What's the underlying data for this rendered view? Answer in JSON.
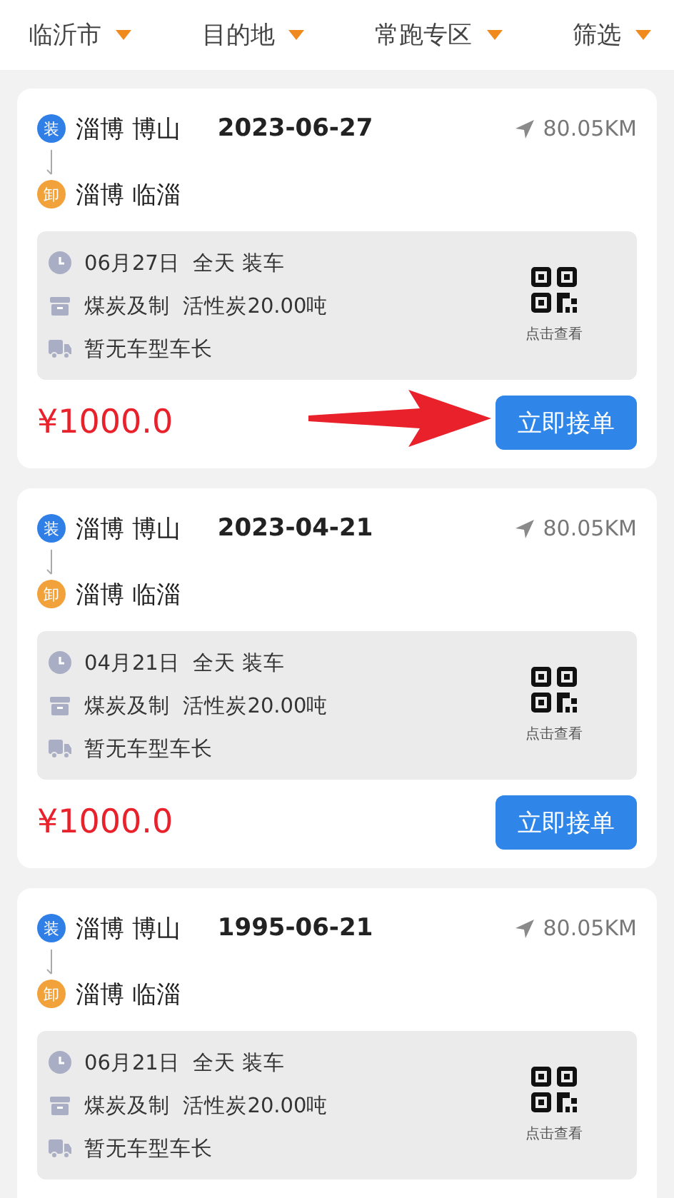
{
  "filters": [
    {
      "label": "临沂市"
    },
    {
      "label": "目的地"
    },
    {
      "label": "常跑专区"
    },
    {
      "label": "筛选"
    }
  ],
  "orders": [
    {
      "load_tag": "装",
      "from": "淄博 博山",
      "date": "2023-06-27",
      "distance": "80.05KM",
      "unload_tag": "卸",
      "to": "淄博 临淄",
      "time": "06月27日  全天 装车",
      "cargo": "煤炭及制  活性炭20.00吨",
      "vehicle": "暂无车型车长",
      "qr_label": "点击查看",
      "price": "¥1000.0",
      "button": "立即接单",
      "pointed": true
    },
    {
      "load_tag": "装",
      "from": "淄博 博山",
      "date": "2023-04-21",
      "distance": "80.05KM",
      "unload_tag": "卸",
      "to": "淄博 临淄",
      "time": "04月21日  全天 装车",
      "cargo": "煤炭及制  活性炭20.00吨",
      "vehicle": "暂无车型车长",
      "qr_label": "点击查看",
      "price": "¥1000.0",
      "button": "立即接单",
      "pointed": false
    },
    {
      "load_tag": "装",
      "from": "淄博 博山",
      "date": "1995-06-21",
      "distance": "80.05KM",
      "unload_tag": "卸",
      "to": "淄博 临淄",
      "time": "06月21日  全天 装车",
      "cargo": "煤炭及制  活性炭20.00吨",
      "vehicle": "暂无车型车长",
      "qr_label": "点击查看",
      "pointed": false
    }
  ]
}
